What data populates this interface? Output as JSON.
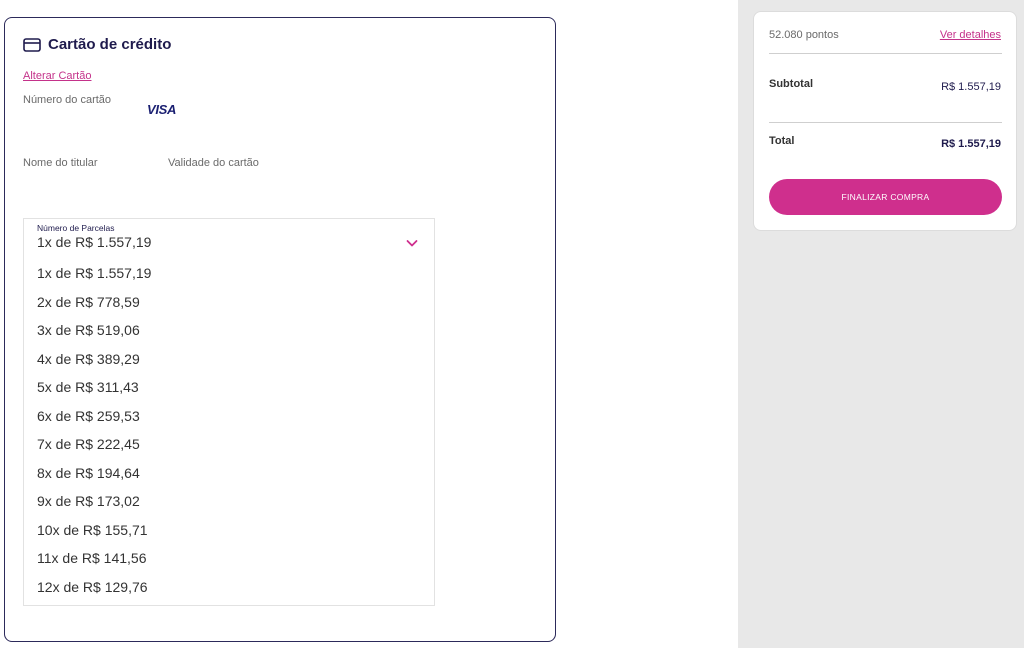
{
  "payment": {
    "title": "Cartão de crédito",
    "change_card": "Alterar Cartão",
    "card_number_label": "Número do cartão",
    "card_brand": "VISA",
    "holder_name_label": "Nome do titular",
    "expiry_label": "Validade do cartão",
    "installments": {
      "label": "Número de Parcelas",
      "selected": "1x de R$ 1.557,19",
      "options": [
        "1x de R$ 1.557,19",
        "2x de R$ 778,59",
        "3x de R$ 519,06",
        "4x de R$ 389,29",
        "5x de R$ 311,43",
        "6x de R$ 259,53",
        "7x de R$ 222,45",
        "8x de R$ 194,64",
        "9x de R$ 173,02",
        "10x de R$ 155,71",
        "11x de R$ 141,56",
        "12x de R$ 129,76"
      ]
    }
  },
  "summary": {
    "points": "52.080 pontos",
    "details_link": "Ver detalhes",
    "subtotal_label": "Subtotal",
    "subtotal_value": "R$ 1.557,19",
    "total_label": "Total",
    "total_value": "R$ 1.557,19",
    "checkout_button": "FINALIZAR COMPRA"
  },
  "colors": {
    "accent": "#cf2f8d",
    "navy": "#1f1b4d",
    "panel_bg": "#e8e8e8"
  },
  "icons": {
    "card": "credit-card-icon",
    "chevron": "chevron-down-icon"
  }
}
